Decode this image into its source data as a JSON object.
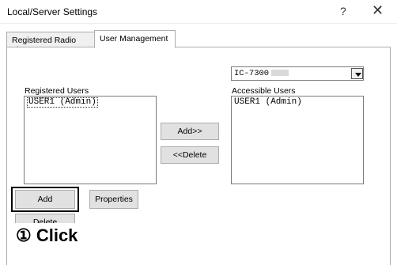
{
  "window": {
    "title": "Local/Server Settings",
    "help_label": "?",
    "close_label": "✕"
  },
  "tabs": [
    {
      "label": "Registered Radio List",
      "active": false
    },
    {
      "label": "User Management",
      "active": true
    }
  ],
  "radio_select": {
    "value": "IC-7300"
  },
  "registered_users": {
    "label": "Registered Users",
    "items": [
      "USER1 (Admin)"
    ]
  },
  "accessible_users": {
    "label": "Accessible Users",
    "items": [
      "USER1 (Admin)"
    ]
  },
  "buttons": {
    "add_to": "Add>>",
    "delete_from": "<<Delete",
    "add": "Add",
    "properties": "Properties",
    "delete": "Delete"
  },
  "callout": {
    "text": "① Click"
  }
}
